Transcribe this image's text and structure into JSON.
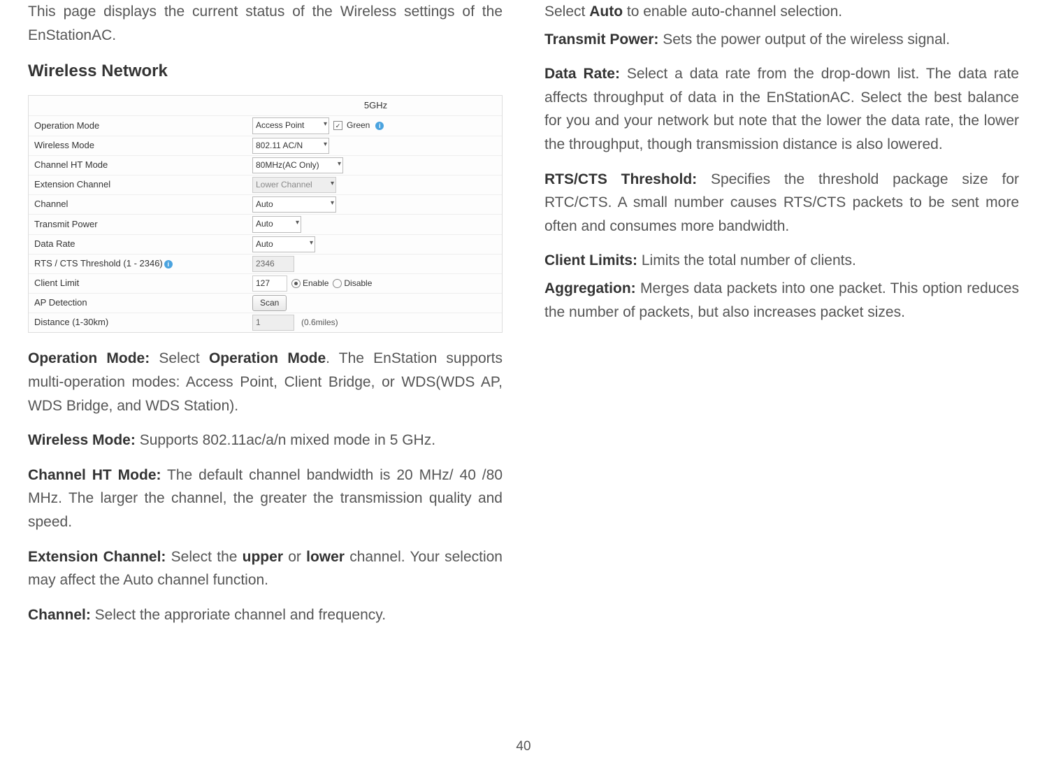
{
  "intro": "This page displays the current status of the Wireless settings of the EnStationAC.",
  "section_title": "Wireless Network",
  "table": {
    "header_blank": "",
    "header_band": "5GHz",
    "rows": {
      "op_mode": {
        "label": "Operation Mode",
        "value": "Access Point",
        "green": "Green"
      },
      "wireless_mode": {
        "label": "Wireless Mode",
        "value": "802.11 AC/N"
      },
      "ht_mode": {
        "label": "Channel HT Mode",
        "value": "80MHz(AC Only)"
      },
      "ext_channel": {
        "label": "Extension Channel",
        "value": "Lower Channel"
      },
      "channel": {
        "label": "Channel",
        "value": "Auto"
      },
      "tx_power": {
        "label": "Transmit Power",
        "value": "Auto"
      },
      "data_rate": {
        "label": "Data Rate",
        "value": "Auto"
      },
      "rts": {
        "label": "RTS / CTS Threshold (1 - 2346)",
        "value": "2346"
      },
      "client_limit": {
        "label": "Client Limit",
        "value": "127",
        "opt_enable": "Enable",
        "opt_disable": "Disable"
      },
      "ap_detection": {
        "label": "AP Detection",
        "button": "Scan"
      },
      "distance": {
        "label": "Distance (1-30km)",
        "value": "1",
        "miles": "(0.6miles)"
      }
    }
  },
  "left": {
    "op_mode_label": "Operation Mode:",
    "op_mode_text1": " Select ",
    "op_mode_bold": "Operation Mode",
    "op_mode_text2": ". The EnStation supports multi-operation modes: Access Point, Client Bridge, or WDS(WDS AP, WDS Bridge, and WDS Station).",
    "wireless_mode_label": "Wireless Mode:",
    "wireless_mode_text": " Supports 802.11ac/a/n mixed mode in 5 GHz.",
    "ht_label": "Channel HT Mode:",
    "ht_text": " The default channel bandwidth is 20 MHz/ 40 /80 MHz. The larger the channel, the greater the transmission quality and speed.",
    "ext_label": "Extension Channel:",
    "ext_text1": " Select the ",
    "ext_upper": "upper",
    "ext_or": " or ",
    "ext_lower": "lower",
    "ext_text2": " channel. Your selection may affect the Auto channel function.",
    "ch_label": "Channel:",
    "ch_text": " Select the approriate channel and frequency."
  },
  "right": {
    "auto_pre": "Select ",
    "auto_bold": "Auto",
    "auto_post": " to enable auto-channel selection.",
    "tx_label": "Transmit Power:",
    "tx_text": " Sets the power output of the wireless signal.",
    "dr_label": "Data Rate:",
    "dr_text": " Select a data rate from the drop-down list. The data rate affects throughput of data in the EnStationAC. Select the best balance for you and your network but note that the lower the data rate, the lower the throughput, though transmission distance is also lowered.",
    "rts_label": "RTS/CTS Threshold:",
    "rts_text": " Specifies the threshold package size for RTC/CTS. A small number causes RTS/CTS packets to be sent more often and consumes more bandwidth.",
    "cl_label": "Client Limits:",
    "cl_text": " Limits the total number of clients.",
    "agg_label": "Aggregation:",
    "agg_text": " Merges data packets into one packet. This option reduces the number of packets, but also increases packet sizes."
  },
  "page_number": "40"
}
